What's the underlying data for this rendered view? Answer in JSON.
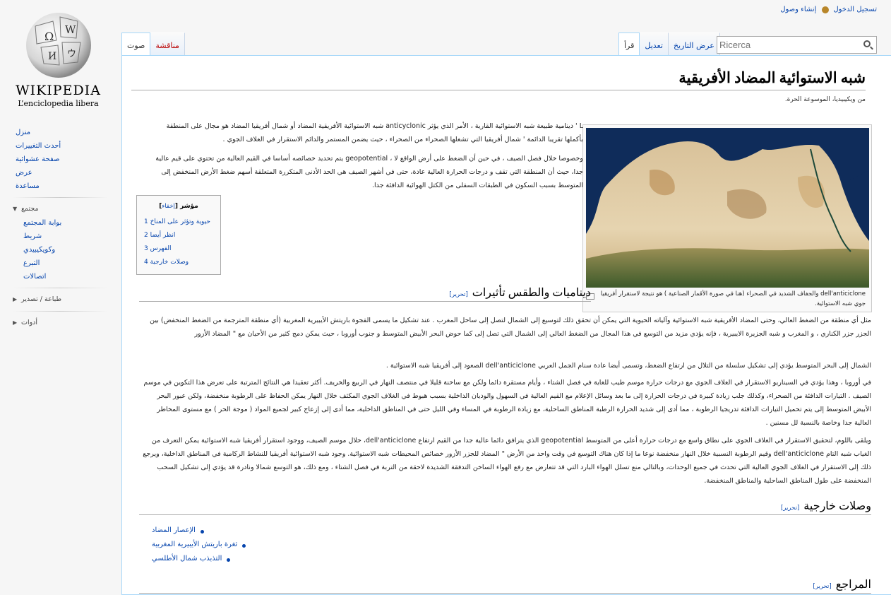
{
  "logo": {
    "wordmark": "WIKIPEDIA",
    "tagline": "L’enciclopedia libera"
  },
  "personal": {
    "login": "تسجيل الدخول",
    "create": "إنشاء وصول"
  },
  "tabs": {
    "page": "صوت",
    "talk": "مناقشة",
    "read": "قرأ",
    "edit": "تعديل",
    "history": "عرض التاريخ"
  },
  "search": {
    "placeholder": "Ricerca"
  },
  "sidebar": {
    "nav": [
      "منزل",
      "أحدث التغييرات",
      "صفحة عشوائية",
      "عرض",
      "مساعدة"
    ],
    "community": {
      "title": "مجتمع",
      "items": [
        "بوابة المجتمع",
        "شريط",
        "وكويكيبيدي",
        "التبرع",
        "اتصالات"
      ]
    },
    "print": "طباعة / تصدير",
    "tools": "أدوات"
  },
  "article": {
    "title": "شبه الاستوائية المضاد الأفريقية",
    "tagline": "من ويكيبيديا، الموسوعة الحرة.",
    "intro1": "L ' دينامية طبيعة شبه الاستوائية القارية ، الأمر الذي يؤثر anticyclonic شبه الاستوائية الأفريقية المضاد أو شمال أفريقيا المضاد هو مجال على المنطقة بأكملها تقريبا الدائمة ' شمال أفريقيا التي تشغلها الصحراء من الصحراء ، حيث يضمن المستمر والدائم الاستقرار في الغلاف الجوي .",
    "intro2": "وخصوصا خلال فصل الصيف ، في حين أن الضغط على أرض الواقع لا ، geopotential يتم تحديد خصائصه أساسا في القيم العالية من تحتوي على قيم عالية جدا، حيث أن المنطقة التي تقف و درجات الحرارة العالية عادة، حتى في أشهر الصيف هي الحد الأدنى المتكررة المتعلقة أسهم ضغط الأرض المنخفض إلى المتوسط بسبب السكون في الطبقات السفلى من الكتل الهوائية الدافئة جدا.",
    "caption": "dell'anticiclone والجفاف الشديد في الصحراء (هنا في صورة الأقمار الصناعية ) هو نتيجة لاستقرار أفريقيا جوي شبه الاستوائية."
  },
  "toc": {
    "title": "مؤشر",
    "hide": "إخفاء",
    "items": [
      {
        "num": "1",
        "label": "حيوية وتؤثر على المناخ"
      },
      {
        "num": "2",
        "label": "انظر أيضا"
      },
      {
        "num": "3",
        "label": "الفهرس"
      },
      {
        "num": "4",
        "label": "وصلات خارجية"
      }
    ]
  },
  "sections": {
    "dynamics": {
      "title": "ديناميات والطقس تأثيرات",
      "edit": "تحرير"
    },
    "external": {
      "title": "وصلات خارجية",
      "edit": "تحرير"
    },
    "refs": {
      "title": "المراجع",
      "edit": "تحرير"
    }
  },
  "body": {
    "p1": "مثل أي منطقة من الضغط العالي، وحتى المضاد الأفريقية شبه الاستوائية وآلياته الحيوية التي يمكن أن تحقق ذلك لتوسيع إلى الشمال لتصل إلى ساحل المغرب . عند تشكيل ما يسمى الفجوة باريتش الأيبيرية المغربية (أي منطقة المترجمة من الضغط المنخفض) بين الجزر جزر الكناري ، و المغرب و شبه الجزيرة الايبيرية ، فإنه يؤدي مزيد من التوسع في هذا المجال من الضغط العالي إلى الشمال التي تصل إلى كما حوض البحر الأبيض المتوسط و جنوب أوروبا ، حيث يمكن دمج كثير من الأحيان مع \" المضاد الأزور",
    "p2": "الشمال إلى البحر المتوسط يؤدي إلى تشكيل سلسلة من التلال من ارتفاع الضغط، وتسمى أيضا عادة سنام الجمل العربي dell'anticiclone الصعود إلى أفريقيا شبه الاستوائية .",
    "p3": "في أوروبا ، وهذا يؤدي في السيناريو الاستقرار في الغلاف الجوي مع درجات حرارة موسم طيب للغاية في فصل الشتاء ، وأيام مستقرة دائما ولكن مع ساخنة قليلا في منتصف النهار في الربيع والخريف. أكثر تعقيدا هي النتائج المترتبة على تعرض هذا التكوين في موسم الصيف . التيارات الدافئة من الصحراء، وكذلك جلب زيادة كبيرة في درجات الحرارة إلى ما بعد وسائل الإعلام مع القيم العالية في السهول والوديان الداخلية بسبب هبوط في الغلاف الجوي المكثف خلال النهار يمكن الحفاظ على الرطوبة منخفضة، ولكن عبور البحر الأبيض المتوسط إلى يتم تحميل التيارات الدافئة تدريجيا الرطوبة ، مما أدى إلى شديد الحرارة الرطبة المناطق الساحلية، مع زيادة الرطوبة في المساء وفي الليل حتى في المناطق الداخلية، مما أدى إلى إزعاج كبير لجميع المواد ( موجة الحر ) مع مستوى المخاطر العالية جدا وخاصة بالنسبة لل مسنين .",
    "p4": "ويلقى باللوم، لتحقيق الاستقرار في الغلاف الجوي على نطاق واسع مع درجات حرارة أعلى من المتوسط geopotential الذي يترافق دائما عالية جدا من القيم ارتفاع dell'anticiclone، خلال موسم الصيف، ووجود استقرار أفريقيا شبه الاستوائية يمكن التعرف من الغياب شبه التام dell'anticiclone وقيم الرطوبة النسبية خلال النهار منخفضة نوعا ما إذا كان هناك التوسع في وقت واحد من الأرض \" المضاد للجزر الأزور خصائص المحيطات شبه الاستوائية. وجود شبه الاستوائية أفريقيا للنشاط الركامية في المناطق الداخلية، ويرجع ذلك إلى الاستقرار في الغلاف الجوي العالية التي تحدث في جميع الوحدات، وبالتالي منع تسلل الهواء البارد التي قد تتعارض مع رفع الهواء الساخن التدفقة الشديدة لاحقة من التربة في فصل الشتاء ، ومع ذلك، هو التوسع شمالا ونادرة قد يؤدي إلى تشكيل السحب المنخفضة على طول المناطق الساحلية والمناطق المنخفضة."
  },
  "external_links": [
    "الإعصار المضاد",
    "ثغرة باريتش الأيبيرية المغربية",
    "التذبذب شمال الأطلسي"
  ],
  "colors": {
    "link": "#0645ad",
    "new_link": "#ba0000",
    "border": "#a7d7f9",
    "background": "#f6f6f6"
  }
}
